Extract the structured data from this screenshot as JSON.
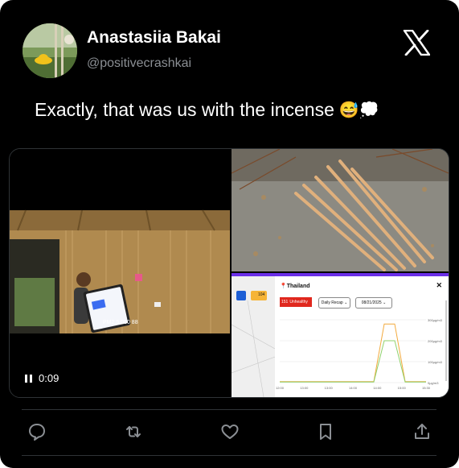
{
  "author": {
    "name": "Anastasiia Bakai",
    "handle": "@positivecrashkai"
  },
  "tweet": {
    "text": "Exactly, that was us with the incense",
    "emoji": "😅💭"
  },
  "video": {
    "timecode": "0:09",
    "screen_text": "PM2.5 060 88"
  },
  "dashboard": {
    "location": "Thailand",
    "dropdown_recap": "Daily Recap",
    "date": "08/21/2025",
    "status_value": "151",
    "status_label": "Unhealthy",
    "map_badge": "104",
    "y_labels": [
      "300μg/m3",
      "200μg/m3",
      "100μg/m3",
      "0μg/m3"
    ],
    "x_labels": [
      "12:00",
      "13:00",
      "13:00",
      "14:00",
      "14:00",
      "15:00",
      "15:30"
    ],
    "close": "✕"
  },
  "chart_data": {
    "type": "line",
    "title": "",
    "xlabel": "",
    "ylabel": "",
    "series": [
      {
        "name": "",
        "color": "#f2a93b",
        "values": [
          5,
          5,
          5,
          5,
          5,
          5,
          5,
          5,
          5,
          5,
          280,
          280,
          5,
          5,
          5
        ]
      },
      {
        "name": "",
        "color": "#8fd16b",
        "values": [
          3,
          3,
          3,
          3,
          3,
          3,
          3,
          3,
          3,
          3,
          200,
          200,
          3,
          3,
          3
        ]
      }
    ],
    "ylim": [
      0,
      300
    ]
  },
  "colors": {
    "background": "#000000",
    "secondary_text": "#8b8f94",
    "border": "#2f3336"
  },
  "icons": [
    "x-logo-icon",
    "reply-icon",
    "retweet-icon",
    "like-icon",
    "bookmark-icon",
    "share-icon",
    "pause-icon"
  ]
}
